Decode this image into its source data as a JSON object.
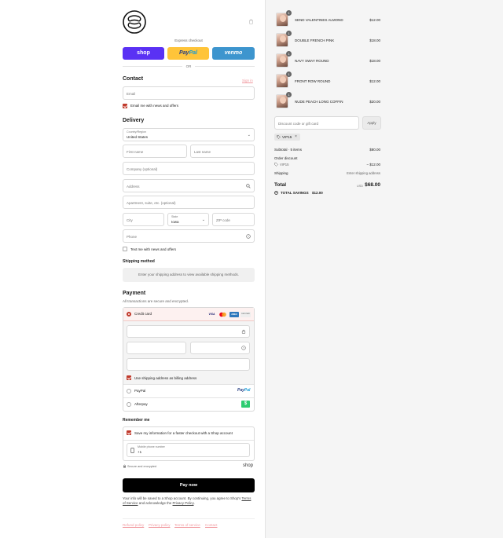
{
  "express": {
    "label": "Express checkout",
    "shop_label": "shop",
    "paypal_label_a": "Pay",
    "paypal_label_b": "Pal",
    "venmo_label": "venmo",
    "or_label": "OR"
  },
  "contact": {
    "heading": "Contact",
    "sign_in": "Sign in",
    "email_placeholder": "Email",
    "email_news_label": "Email me with news and offers",
    "email_news_checked": true
  },
  "delivery": {
    "heading": "Delivery",
    "country_label": "Country/Region",
    "country_value": "United States",
    "first_name_placeholder": "First name",
    "last_name_placeholder": "Last name",
    "company_placeholder": "Company (optional)",
    "address_placeholder": "Address",
    "apartment_placeholder": "Apartment, suite, etc. (optional)",
    "city_placeholder": "City",
    "state_label": "State",
    "state_value": "Iowa",
    "zip_placeholder": "ZIP code",
    "phone_placeholder": "Phone",
    "text_news_label": "Text me with news and offers",
    "text_news_checked": false
  },
  "shipping": {
    "heading": "Shipping method",
    "note": "Enter your shipping address to view available shipping methods."
  },
  "payment": {
    "heading": "Payment",
    "subtext": "All transactions are secure and encrypted.",
    "credit_card_label": "Credit card",
    "card_brands": [
      "VISA",
      "MC",
      "AMEX",
      "DISCOVER"
    ],
    "billing_label": "Use shipping address as billing address",
    "paypal_label": "PayPal",
    "paypal_logo_a": "Pay",
    "paypal_logo_b": "Pal",
    "afterpay_label": "Afterpay",
    "afterpay_logo": "$"
  },
  "remember": {
    "heading": "Remember me",
    "save_label": "Save my information for a faster checkout with a Shop account",
    "phone_label": "Mobile phone number",
    "phone_value": "+1",
    "secure_label": "Secure and encrypted",
    "shop_label": "shop"
  },
  "pay_now_label": "Pay now",
  "legal": {
    "text_a": "Your info will be saved to a Shop account. By continuing, you agree to Shop's",
    "terms_link": "Terms of Service",
    "text_b": "and acknowledge the",
    "privacy_link": "Privacy Policy"
  },
  "footer_links": [
    "Refund policy",
    "Privacy policy",
    "Terms of service",
    "Contact"
  ],
  "order": {
    "items": [
      {
        "name": "SEND VALENTINES ALMOND",
        "price": "$12.00",
        "qty": "1"
      },
      {
        "name": "DOUBLE FRENCH PINK",
        "price": "$18.00",
        "qty": "1"
      },
      {
        "name": "NAVY SWAY ROUND",
        "price": "$18.00",
        "qty": "1"
      },
      {
        "name": "FRONT ROW ROUND",
        "price": "$12.00",
        "qty": "1"
      },
      {
        "name": "NUDE PEACH LONG COFFIN",
        "price": "$20.00",
        "qty": "1"
      }
    ],
    "discount_placeholder": "Discount code or gift card",
    "apply_label": "Apply",
    "applied_code": "VIP15",
    "subtotal_label": "Subtotal · 5 items",
    "subtotal_value": "$80.00",
    "order_discount_label": "Order discount",
    "discount_code": "VIP15",
    "discount_value": "− $12.00",
    "shipping_label": "Shipping",
    "shipping_value": "Enter shipping address",
    "total_label": "Total",
    "currency": "USD",
    "total_value": "$68.00",
    "savings_label": "TOTAL SAVINGS",
    "savings_value": "$12.00"
  },
  "colors": {
    "shop_purple": "#5a31f4",
    "paypal_yellow": "#ffc439",
    "venmo_blue": "#3d95ce",
    "accent_red": "#c0392b",
    "link_pink": "#f19aa0"
  }
}
